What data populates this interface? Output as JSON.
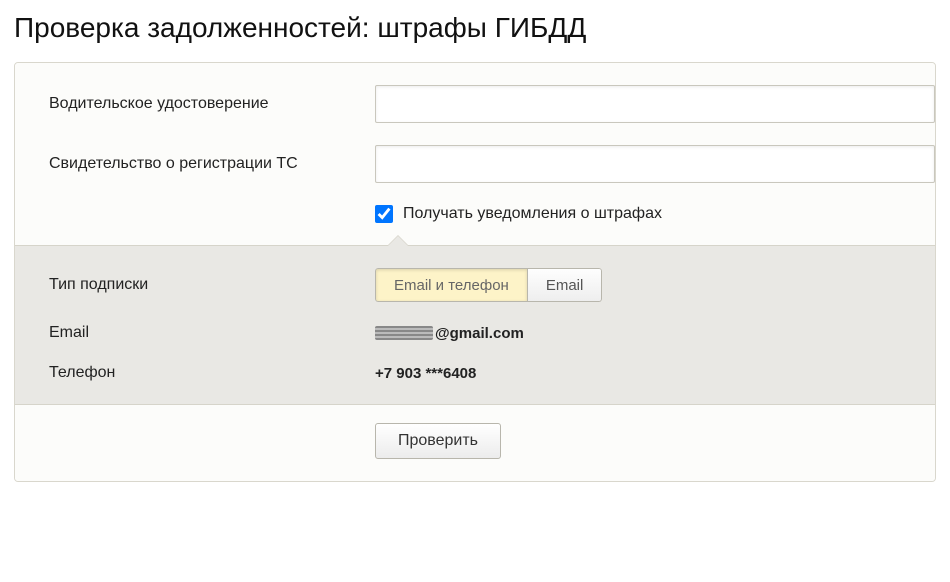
{
  "title": "Проверка задолженностей: штрафы ГИБДД",
  "form": {
    "driver_license": {
      "label": "Водительское удостоверение",
      "value": ""
    },
    "vehicle_cert": {
      "label": "Свидетельство о регистрации ТС",
      "value": ""
    },
    "notifications": {
      "label": "Получать уведомления о штрафах",
      "checked": true
    }
  },
  "subscription": {
    "type_label": "Тип подписки",
    "options": {
      "both": "Email и телефон",
      "email": "Email"
    },
    "selected": "both",
    "email_label": "Email",
    "email_value": "@gmail.com",
    "phone_label": "Телефон",
    "phone_value": "+7 903 ***6408"
  },
  "submit_label": "Проверить"
}
